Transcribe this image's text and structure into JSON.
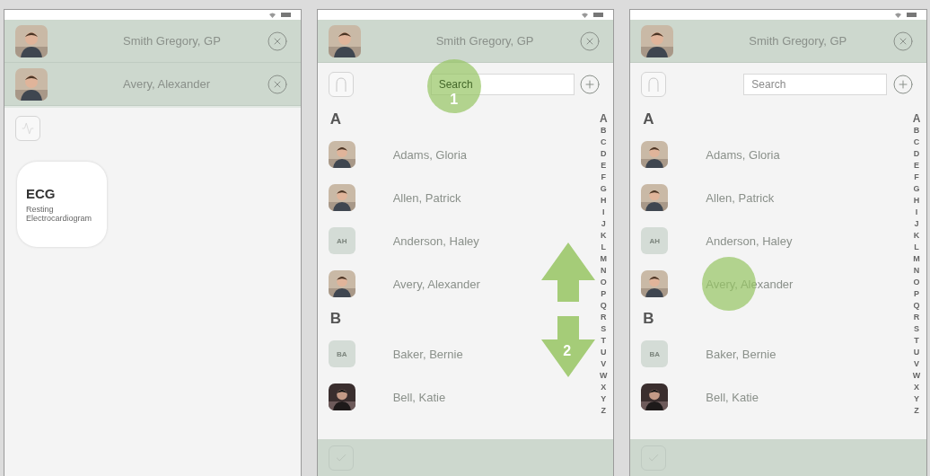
{
  "panels": [
    {
      "kind": "home",
      "patients": [
        {
          "name": "Smith Gregory, GP"
        },
        {
          "name": "Avery, Alexander"
        }
      ],
      "tests": [
        {
          "title": "ECG",
          "subtitle": "Resting Electrocardiogram"
        }
      ]
    },
    {
      "kind": "search",
      "patients": [
        {
          "name": "Smith Gregory, GP"
        }
      ],
      "search": {
        "placeholder": "Search",
        "highlighted": true,
        "callout": "1"
      },
      "sections": [
        {
          "letter": "A",
          "contacts": [
            {
              "name": "Adams, Gloria",
              "highlighted": false
            },
            {
              "name": "Allen, Patrick",
              "highlighted": false
            },
            {
              "name": "Anderson, Haley",
              "highlighted": false,
              "avatar": {
                "kind": "initials",
                "text": "AH"
              }
            },
            {
              "name": "Avery, Alexander",
              "highlighted": false
            }
          ]
        },
        {
          "letter": "B",
          "contacts": [
            {
              "name": "Baker, Bernie",
              "highlighted": false,
              "avatar": {
                "kind": "initials",
                "text": "BA"
              }
            },
            {
              "name": "Bell, Katie",
              "highlighted": false
            }
          ]
        }
      ],
      "index": [
        "A",
        "B",
        "C",
        "D",
        "E",
        "F",
        "G",
        "H",
        "I",
        "J",
        "K",
        "L",
        "M",
        "N",
        "O",
        "P",
        "Q",
        "R",
        "S",
        "T",
        "U",
        "V",
        "W",
        "X",
        "Y",
        "Z"
      ],
      "scroll_hint": {
        "label": "2"
      }
    },
    {
      "kind": "search",
      "patients": [
        {
          "name": "Smith Gregory, GP"
        }
      ],
      "search": {
        "placeholder": "Search",
        "highlighted": false
      },
      "sections": [
        {
          "letter": "A",
          "contacts": [
            {
              "name": "Adams, Gloria",
              "highlighted": false
            },
            {
              "name": "Allen, Patrick",
              "highlighted": false
            },
            {
              "name": "Anderson, Haley",
              "highlighted": false,
              "avatar": {
                "kind": "initials",
                "text": "AH"
              }
            },
            {
              "name": "Avery, Alexander",
              "highlighted": true
            }
          ]
        },
        {
          "letter": "B",
          "contacts": [
            {
              "name": "Baker, Bernie",
              "highlighted": false,
              "avatar": {
                "kind": "initials",
                "text": "BA"
              }
            },
            {
              "name": "Bell, Katie",
              "highlighted": false
            }
          ]
        }
      ],
      "index": [
        "A",
        "B",
        "C",
        "D",
        "E",
        "F",
        "G",
        "H",
        "I",
        "J",
        "K",
        "L",
        "M",
        "N",
        "O",
        "P",
        "Q",
        "R",
        "S",
        "T",
        "U",
        "V",
        "W",
        "X",
        "Y",
        "Z"
      ]
    }
  ]
}
